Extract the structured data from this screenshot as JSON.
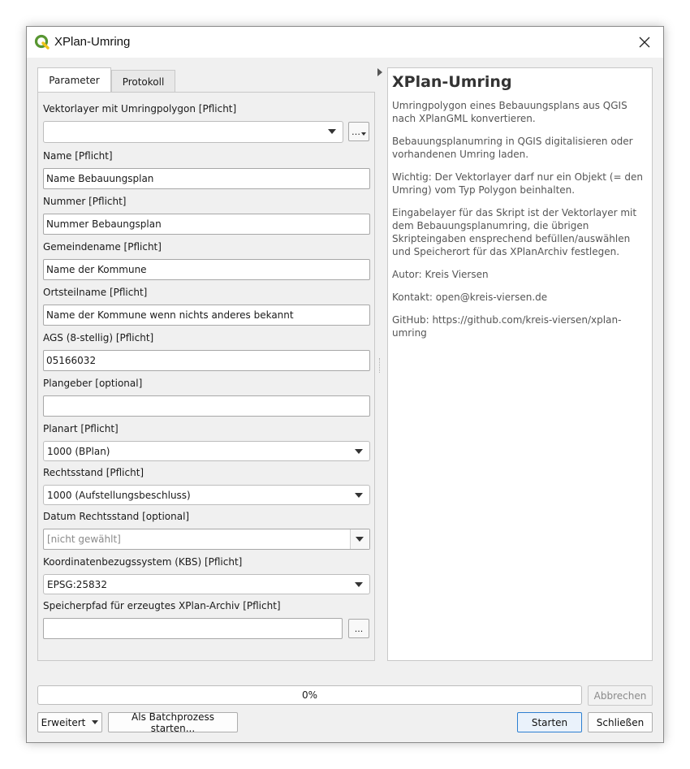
{
  "window": {
    "title": "XPlan-Umring",
    "close_glyph": "✕",
    "app_icon": "qgis-icon",
    "accent_color": "#589632"
  },
  "tabs": [
    {
      "label": "Parameter",
      "active": true
    },
    {
      "label": "Protokoll",
      "active": false
    }
  ],
  "form": {
    "vector_layer": {
      "label": "Vektorlayer mit Umringpolygon [Pflicht]",
      "value": "",
      "button": "…"
    },
    "name": {
      "label": "Name [Pflicht]",
      "value": "Name Bebauungsplan"
    },
    "nummer": {
      "label": "Nummer [Pflicht]",
      "value": "Nummer Bebaungsplan"
    },
    "gemeindename": {
      "label": "Gemeindename [Pflicht]",
      "value": "Name der Kommune"
    },
    "ortsteilname": {
      "label": "Ortsteilname [Pflicht]",
      "value": "Name der Kommune wenn nichts anderes bekannt"
    },
    "ags": {
      "label": "AGS (8-stellig) [Pflicht]",
      "value": "05166032"
    },
    "plangeber": {
      "label": "Plangeber [optional]",
      "value": ""
    },
    "planart": {
      "label": "Planart [Pflicht]",
      "value": "1000 (BPlan)"
    },
    "rechtsstand": {
      "label": "Rechtsstand [Pflicht]",
      "value": "1000 (Aufstellungsbeschluss)"
    },
    "datum": {
      "label": "Datum Rechtsstand [optional]",
      "value": "[nicht gewählt]"
    },
    "kbs": {
      "label": "Koordinatenbezugssystem (KBS) [Pflicht]",
      "value": "EPSG:25832"
    },
    "speicherpfad": {
      "label": "Speicherpfad für erzeugtes XPlan-Archiv [Pflicht]",
      "value": "",
      "button": "..."
    }
  },
  "help": {
    "title": "XPlan-Umring",
    "paragraphs": [
      "Umringpolygon eines Bebauungsplans aus QGIS nach XPlanGML konvertieren.",
      "Bebauungsplanumring in QGIS digitalisieren oder vorhandenen Umring laden.",
      "Wichtig: Der Vektorlayer darf nur ein Objekt (= den Umring) vom Typ Polygon beinhalten.",
      "Eingabelayer für das Skript ist der Vektorlayer mit dem Bebauungsplanumring, die übrigen Skripteingaben ensprechend befüllen/auswählen und Speicherort für das XPlanArchiv festlegen.",
      "Autor: Kreis Viersen",
      "Kontakt: open@kreis-viersen.de",
      "GitHub: https://github.com/kreis-viersen/xplan-umring"
    ]
  },
  "progress": {
    "value": 0,
    "label": "0%"
  },
  "buttons": {
    "abbrechen": "Abbrechen",
    "erweitert": "Erweitert",
    "batch": "Als Batchprozess starten...",
    "starten": "Starten",
    "schliessen": "Schließen"
  }
}
